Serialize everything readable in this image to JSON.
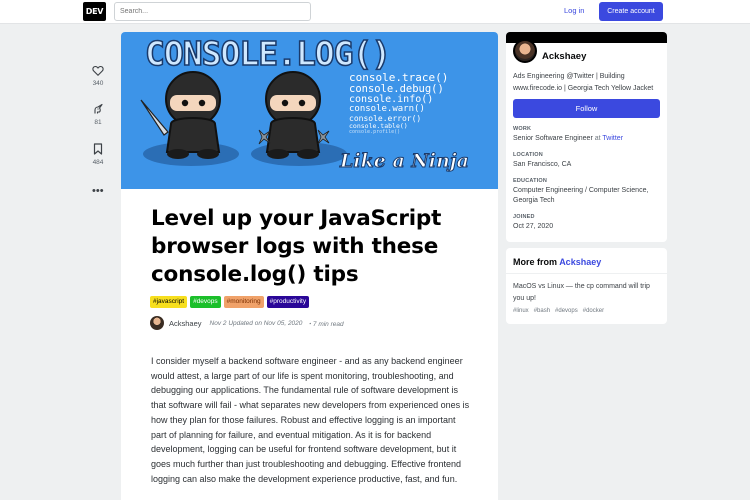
{
  "header": {
    "logo": "DEV",
    "search_placeholder": "Search...",
    "login": "Log in",
    "create_account": "Create account"
  },
  "reactions": {
    "likes": "340",
    "unicorns": "81",
    "bookmarks": "484",
    "more": "•••"
  },
  "cover": {
    "title": "CONSOLE.LOG()",
    "code_lines": [
      "console.trace()",
      "console.debug()",
      "console.info()",
      "console.warn()",
      "console.error()",
      "console.table()",
      "console.profile()"
    ],
    "tagline": "Like a Ninja",
    "colors": {
      "background": "#3d94e8",
      "text": "#ffffff"
    }
  },
  "article": {
    "title": "Level up your JavaScript browser logs with these console.log() tips",
    "tags": [
      {
        "label": "#javascript",
        "bg": "#f7df1e",
        "fg": "#000000"
      },
      {
        "label": "#devops",
        "bg": "#1bbf2a",
        "fg": "#ffffff"
      },
      {
        "label": "#monitoring",
        "bg": "#f0a26a",
        "fg": "#7a2e00"
      },
      {
        "label": "#productivity",
        "bg": "#2a0798",
        "fg": "#ffffff"
      }
    ],
    "author": "Ackshaey",
    "meta": "Nov 2 Updated on Nov 05, 2020",
    "read_time": "・7 min read",
    "body": "I consider myself a backend software engineer - and as any backend engineer would attest, a large part of our life is spent monitoring, troubleshooting, and debugging our applications. The fundamental rule of software development is that software will fail - what separates new developers from experienced ones is how they plan for those failures. Robust and effective logging is an important part of planning for failure, and eventual mitigation. As it is for backend development, logging can be useful for frontend software development, but it goes much further than just troubleshooting and debugging. Effective frontend logging can also make the development experience productive, fast, and fun."
  },
  "profile": {
    "name": "Ackshaey",
    "bio": "Ads Engineering @Twitter | Building www.firecode.io | Georgia Tech Yellow Jacket",
    "follow": "Follow",
    "work_label": "WORK",
    "work_value": "Senior Software Engineer",
    "work_at": "at",
    "work_company": "Twitter",
    "location_label": "LOCATION",
    "location_value": "San Francisco, CA",
    "education_label": "EDUCATION",
    "education_value": "Computer Engineering / Computer Science, Georgia Tech",
    "joined_label": "JOINED",
    "joined_value": "Oct 27, 2020"
  },
  "more_from": {
    "heading": "More from",
    "author": "Ackshaey",
    "post_title": "MacOS vs Linux — the cp command will trip you up!",
    "tags": [
      "#linux",
      "#bash",
      "#devops",
      "#docker"
    ]
  }
}
